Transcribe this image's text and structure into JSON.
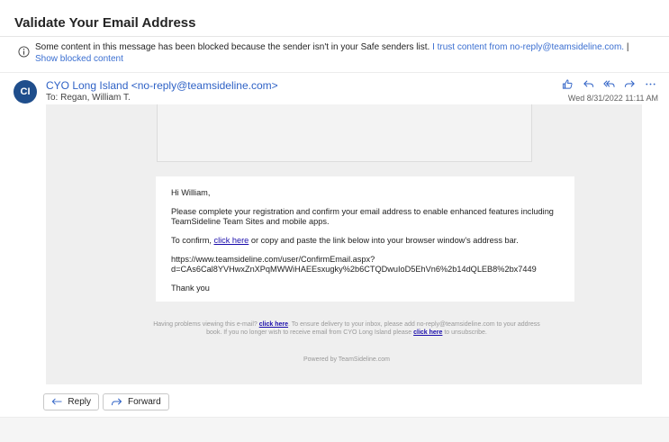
{
  "subject": "Validate Your Email Address",
  "warning": {
    "text": "Some content in this message has been blocked because the sender isn't in your Safe senders list.",
    "trust_link": "I trust content from no-reply@teamsideline.com.",
    "separator": "|",
    "show_link": "Show blocked content"
  },
  "sender": {
    "initials": "CI",
    "display": "CYO Long Island <no-reply@teamsideline.com>",
    "to": "To:  Regan, William T.",
    "date": "Wed 8/31/2022 11:11 AM"
  },
  "body": {
    "greeting": "Hi William,",
    "para1": "Please complete your registration and confirm your email address to enable enhanced features including TeamSideline Team Sites and mobile apps.",
    "para2_before": "To confirm, ",
    "para2_link": "click here",
    "para2_after": " or copy and paste the link below into your browser window's address bar.",
    "url_line1": "https://www.teamsideline.com/user/ConfirmEmail.aspx?",
    "url_line2": "d=CAs6Cal8YVHwxZnXPqMWWiHAEEsxugky%2b6CTQDwuIoD5EhVn6%2b14dQLEB8%2bx7449",
    "closing": "Thank you"
  },
  "footer": {
    "part1": "Having problems viewing this e-mail? ",
    "link1": "click here",
    "part2": ". To ensure delivery to your inbox, please add no-reply@teamsideline.com to your address book. If you no longer wish to receive email from CYO Long Island please ",
    "link2": "click here",
    "part3": " to unsubscribe.",
    "powered": "Powered by TeamSideline.com"
  },
  "buttons": {
    "reply": "Reply",
    "forward": "Forward"
  },
  "colors": {
    "accent": "#2f62c6",
    "avatar": "#1f4e8c",
    "link": "#1a0dab"
  }
}
